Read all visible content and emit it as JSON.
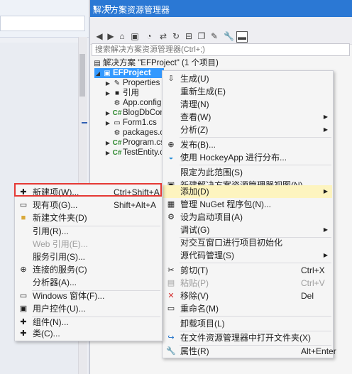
{
  "solution_explorer": {
    "title": "解决方案资源管理器",
    "title_buttons": "▾ ⊟ ×",
    "search_placeholder": "搜索解决方案资源管理器(Ctrl+;)",
    "tree": [
      {
        "label": "解决方案 \"EFProject\" (1 个项目)"
      },
      {
        "label": "EFProject"
      },
      {
        "label": "Properties"
      },
      {
        "label": "引用"
      },
      {
        "label": "App.config"
      },
      {
        "label": "BlogDbCon"
      },
      {
        "label": "Form1.cs"
      },
      {
        "label": "packages.c"
      },
      {
        "label": "Program.cs"
      },
      {
        "label": "TestEntity.c"
      }
    ]
  },
  "project_menu": [
    {
      "label": "生成(U)"
    },
    {
      "label": "重新生成(E)"
    },
    {
      "label": "清理(N)"
    },
    {
      "label": "查看(W)"
    },
    {
      "label": "分析(Z)"
    },
    {
      "label": "发布(B)..."
    },
    {
      "label": "使用 HockeyApp 进行分布..."
    },
    {
      "label": "限定为此范围(S)"
    },
    {
      "label": "新建解决方案资源管理器视图(N)"
    },
    {
      "label": "添加(D)"
    },
    {
      "label": "管理 NuGet 程序包(N)..."
    },
    {
      "label": "设为启动项目(A)"
    },
    {
      "label": "调试(G)"
    },
    {
      "label": "对交互窗口进行项目初始化"
    },
    {
      "label": "源代码管理(S)"
    },
    {
      "label": "剪切(T)",
      "shortcut": "Ctrl+X"
    },
    {
      "label": "粘贴(P)",
      "shortcut": "Ctrl+V"
    },
    {
      "label": "移除(V)",
      "shortcut": "Del"
    },
    {
      "label": "重命名(M)"
    },
    {
      "label": "卸载项目(L)"
    },
    {
      "label": "在文件资源管理器中打开文件夹(X)"
    },
    {
      "label": "属性(R)",
      "shortcut": "Alt+Enter"
    }
  ],
  "add_menu": [
    {
      "label": "新建项(W)...",
      "shortcut": "Ctrl+Shift+A"
    },
    {
      "label": "现有项(G)...",
      "shortcut": "Shift+Alt+A"
    },
    {
      "label": "新建文件夹(D)"
    },
    {
      "label": "引用(R)..."
    },
    {
      "label": "Web 引用(E)..."
    },
    {
      "label": "服务引用(S)..."
    },
    {
      "label": "连接的服务(C)"
    },
    {
      "label": "分析器(A)..."
    },
    {
      "label": "Windows 窗体(F)..."
    },
    {
      "label": "用户控件(U)..."
    },
    {
      "label": "组件(N)..."
    },
    {
      "label": "类(C)..."
    }
  ]
}
